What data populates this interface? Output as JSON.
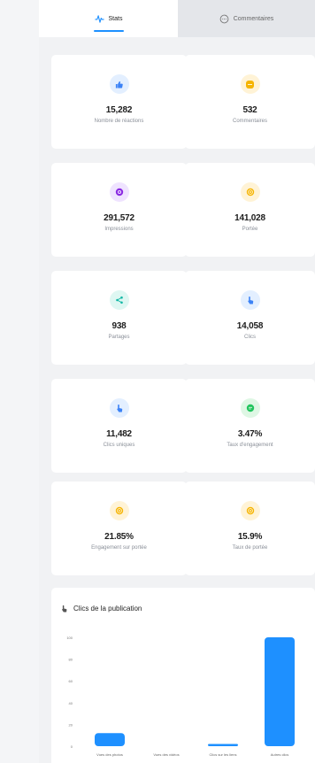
{
  "tabs": [
    {
      "label": "Stats",
      "icon": "activity-icon",
      "active": true
    },
    {
      "label": "Commentaires",
      "icon": "comment-icon",
      "active": false
    }
  ],
  "colors": {
    "accent": "#1e90ff",
    "blue_bg": "#e3efff",
    "blue": "#3b82f6",
    "orange_bg": "#fff3d6",
    "orange": "#f5b400",
    "purple_bg": "#efe3ff",
    "purple": "#8b2be2",
    "teal_bg": "#def7f2",
    "teal": "#14b8a6",
    "green_bg": "#def7e4",
    "green": "#22c55e"
  },
  "stats": [
    {
      "value": "15,282",
      "label": "Nombre de réactions",
      "icon": "thumbs-up-icon",
      "color": "blue"
    },
    {
      "value": "532",
      "label": "Commentaires",
      "icon": "comment-icon",
      "color": "orange"
    },
    {
      "value": "291,572",
      "label": "Impressions",
      "icon": "eye-icon",
      "color": "purple"
    },
    {
      "value": "141,028",
      "label": "Portée",
      "icon": "reach-icon",
      "color": "orange"
    },
    {
      "value": "938",
      "label": "Partages",
      "icon": "share-icon",
      "color": "teal"
    },
    {
      "value": "14,058",
      "label": "Clics",
      "icon": "pointer-icon",
      "color": "blue"
    },
    {
      "value": "11,482",
      "label": "Clics uniques",
      "icon": "pointer-icon",
      "color": "blue"
    },
    {
      "value": "3.47%",
      "label": "Taux d'engagement",
      "icon": "chat-icon",
      "color": "green"
    },
    {
      "value": "21.85%",
      "label": "Engagement sur portée",
      "icon": "reach-icon",
      "color": "orange"
    },
    {
      "value": "15.9%",
      "label": "Taux de portée",
      "icon": "reach-icon",
      "color": "orange"
    }
  ],
  "chart": {
    "title": "Clics de la publication",
    "icon": "pointer-icon"
  },
  "chart_data": {
    "type": "bar",
    "categories": [
      "Vues des photos",
      "Vues des vidéos",
      "Clics sur les liens",
      "Autres clics"
    ],
    "values": [
      12,
      0,
      2,
      100
    ],
    "yticks": [
      "0",
      "20",
      "40",
      "60",
      "80",
      "100"
    ],
    "ylim": [
      0,
      100
    ],
    "color": "#1e90ff",
    "grid": false
  }
}
